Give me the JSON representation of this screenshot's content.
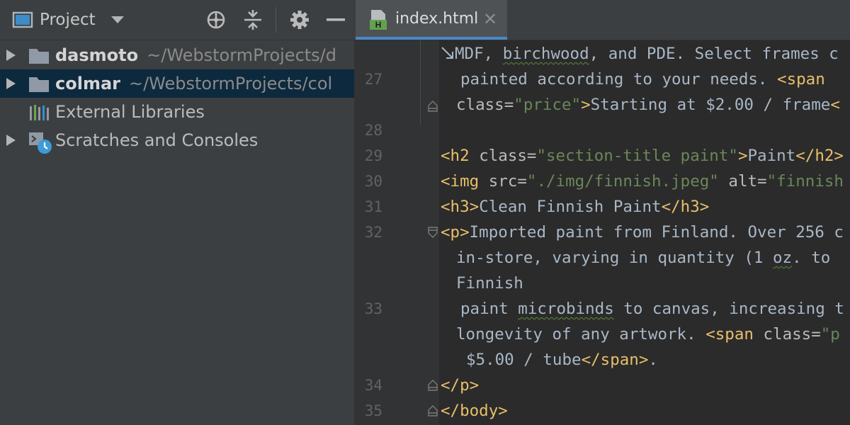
{
  "project_panel": {
    "title": "Project",
    "icons": [
      "project-view-icon",
      "dropdown-chevron-icon",
      "locate-icon",
      "collapse-all-icon",
      "gear-icon",
      "minimize-icon"
    ],
    "tree": [
      {
        "name": "dasmoto",
        "path": "~/WebstormProjects/d",
        "bold": true,
        "expandable": true,
        "icon": "folder-icon"
      },
      {
        "name": "colmar",
        "path": "~/WebstormProjects/col",
        "bold": true,
        "expandable": true,
        "selected": true,
        "icon": "folder-icon"
      },
      {
        "name": "External Libraries",
        "path": "",
        "bold": false,
        "expandable": false,
        "icon": "libraries-icon"
      },
      {
        "name": "Scratches and Consoles",
        "path": "",
        "bold": false,
        "expandable": true,
        "icon": "scratches-icon"
      }
    ]
  },
  "editor": {
    "tab": {
      "label": "index.html",
      "icon": "html-file-icon"
    },
    "line_numbers": {
      "l27": "27",
      "l28": "28",
      "l29": "29",
      "l30": "30",
      "l31": "31",
      "l32": "32",
      "l33": "33",
      "l34": "34",
      "l35": "35"
    },
    "code": {
      "v0_a": "MDF, ",
      "v0_b": "birchwood",
      "v0_c": ", and PDE. Select frames c",
      "v1_a": "painted according to your needs. ",
      "v1_b": "<span",
      "v2_a": "class=",
      "v2_b": "\"price\"",
      "v2_c": ">",
      "v2_d": "Starting at $2.00 / frame",
      "v2_e": "<",
      "v4_a": "<h2 ",
      "v4_b": "class=",
      "v4_c": "\"section-title paint\"",
      "v4_d": ">",
      "v4_e": "Paint",
      "v4_f": "</h2>",
      "v5_a": "<img ",
      "v5_b": "src=",
      "v5_c": "\"./img/finnish.jpeg\"",
      "v5_d": " alt=",
      "v5_e": "\"finnish",
      "v6_a": "<h3>",
      "v6_b": "Clean Finnish Paint",
      "v6_c": "</h3>",
      "v7_a": "<p>",
      "v7_b": "Imported paint from Finland. Over 256 c",
      "v8_a": "in-store, varying in quantity (1 ",
      "v8_b": "oz",
      "v8_c": ". to",
      "v9_a": "Finnish",
      "v10_a": "paint ",
      "v10_b": "microbinds",
      "v10_c": " to canvas, increasing t",
      "v11_a": "longevity of any artwork. ",
      "v11_b": "<span ",
      "v11_c": "class=",
      "v11_d": "\"p",
      "v12_a": "$5.00 / tube",
      "v12_b": "</span>",
      "v12_c": ".",
      "v13_a": "</p>",
      "v14_a": "</body>"
    }
  },
  "colors": {
    "panel_bg": "#3c3f41",
    "editor_bg": "#2b2b2b",
    "selection": "#0d293e",
    "tab_active": "#4e5254",
    "tab_accent": "#4a88c7",
    "tag": "#e8bf6a",
    "attr_value": "#6a8759",
    "text": "#a9b7c6"
  }
}
